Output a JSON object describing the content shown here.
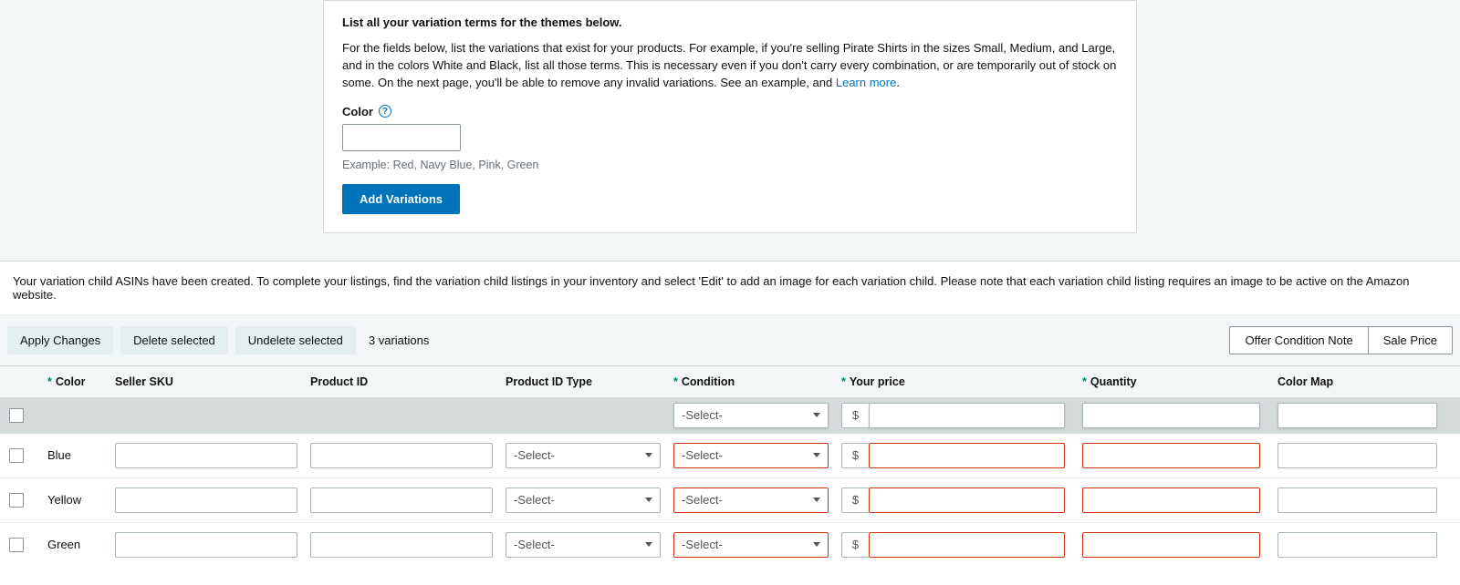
{
  "variation_card": {
    "heading": "List all your variation terms for the themes below.",
    "description_before_link": "For the fields below, list the variations that exist for your products. For example, if you're selling Pirate Shirts in the sizes Small, Medium, and Large, and in the colors White and Black, list all those terms. This is necessary even if you don't carry every combination, or are temporarily out of stock on some. On the next page, you'll be able to remove any invalid variations. See an example, and ",
    "learn_more": "Learn more",
    "description_after_link": ".",
    "color_label": "Color",
    "color_example": "Example: Red, Navy Blue, Pink, Green",
    "add_btn": "Add Variations"
  },
  "notice": "Your variation child ASINs have been created. To complete your listings, find the variation child listings in your inventory and select 'Edit' to add an image for each variation child. Please note that each variation child listing requires an image to be active on the Amazon website.",
  "toolbar": {
    "apply": "Apply Changes",
    "delete": "Delete selected",
    "undelete": "Undelete selected",
    "count": "3 variations",
    "offer_note": "Offer Condition Note",
    "sale_price": "Sale Price"
  },
  "headers": {
    "color": "Color",
    "sku": "Seller SKU",
    "pid": "Product ID",
    "pid_type": "Product ID Type",
    "condition": "Condition",
    "price": "Your price",
    "qty": "Quantity",
    "color_map": "Color Map"
  },
  "select_placeholder": "-Select-",
  "currency": "$",
  "rows": [
    {
      "color": "Blue"
    },
    {
      "color": "Yellow"
    },
    {
      "color": "Green"
    }
  ]
}
